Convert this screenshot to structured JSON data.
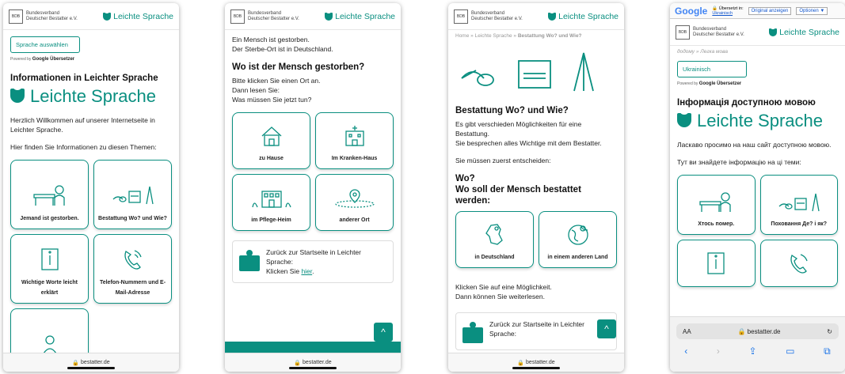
{
  "shared": {
    "org_name_1": "Bundesverband",
    "org_name_2": "Deutscher Bestatter e.V.",
    "ls_link": "Leichte Sprache",
    "url": "bestatter.de",
    "colors": {
      "accent": "#0a8f80"
    }
  },
  "screen1": {
    "lang_button": "Sprache auswählen",
    "powered_by": "Powered by",
    "google_translate": "Google Übersetzer",
    "heading": "Informationen in Leichter Sprache",
    "big_logo": "Leichte Sprache",
    "welcome": "Herzlich Willkommen auf unserer Internetseite in Leichter Sprache.",
    "intro": "Hier finden Sie Informationen zu diesen Themen:",
    "tiles": [
      "Jemand ist gestorben.",
      "Bestattung Wo? und Wie?",
      "Wichtige Worte leicht erklärt",
      "Telefon-Nummern und E-Mail-Adresse"
    ]
  },
  "screen2": {
    "line1": "Ein Mensch ist gestorben.",
    "line2": "Der Sterbe-Ort ist in Deutschland.",
    "heading": "Wo ist der Mensch gestorben?",
    "instr1": "Bitte klicken Sie einen Ort an.",
    "instr2": "Dann lesen Sie:",
    "instr3": "Was müssen Sie jetzt tun?",
    "tiles": [
      "zu Hause",
      "Im Kranken-Haus",
      "im Pflege-Heim",
      "anderer Ort"
    ],
    "back1": "Zurück zur Startseite in Leichter Sprache:",
    "back2": "Klicken Sie",
    "back_link": "hier",
    "up": "^"
  },
  "screen3": {
    "crumb_home": "Home",
    "crumb_sep": "»",
    "crumb_ls": "Leichte Sprache",
    "crumb_current": "Bestattung Wo? und Wie?",
    "heading": "Bestattung Wo? und Wie?",
    "p1": "Es gibt verschieden Möglichkeiten für eine Bestattung.",
    "p2": "Sie besprechen alles Wichtige mit dem Bestatter.",
    "p3": "Sie müssen zuerst entscheiden:",
    "q1": "Wo?",
    "q2": "Wo soll der Mensch bestattet werden:",
    "tiles": [
      "in Deutschland",
      "in einem anderen Land"
    ],
    "click1": "Klicken Sie auf eine Möglichkeit.",
    "click2": "Dann können Sie weiterlesen.",
    "back": "Zurück zur Startseite in Leichter Sprache:",
    "up": "^"
  },
  "screen4": {
    "google": "Google",
    "translated_into": "Übersetzt in:",
    "lang": "Ukrainisch",
    "original": "Original anzeigen",
    "options": "Optionen ▼",
    "crumb": "додому » Легка мова",
    "lang_button": "Ukrainisch",
    "powered_by": "Powered by",
    "google_translate": "Google Übersetzer",
    "heading": "Інформація доступною мовою",
    "big_logo": "Leichte Sprache",
    "welcome": "Ласкаво просимо на наш сайт доступною мовою.",
    "intro": "Тут ви знайдете інформацію на ці теми:",
    "tiles": [
      "Хтось помер.",
      "Поховання Де? і як?"
    ],
    "aa": "AA",
    "reload": "↻"
  }
}
